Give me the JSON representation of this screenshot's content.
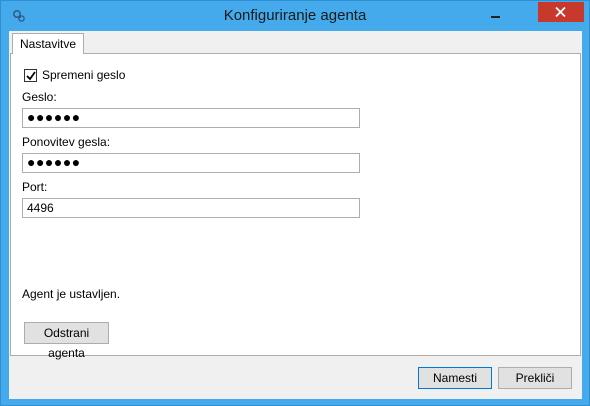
{
  "window": {
    "title": "Konfiguriranje agenta"
  },
  "tabs": [
    {
      "label": "Nastavitve"
    }
  ],
  "settings": {
    "change_password": {
      "label": "Spremeni geslo",
      "checked": true
    },
    "password": {
      "label": "Geslo:",
      "value": "●●●●●●"
    },
    "password_repeat": {
      "label": "Ponovitev gesla:",
      "value": "●●●●●●"
    },
    "port": {
      "label": "Port:",
      "value": "4496"
    },
    "status": "Agent je ustavljen.",
    "remove_label": "Odstrani agenta"
  },
  "footer": {
    "install_label": "Namesti",
    "cancel_label": "Prekliči"
  },
  "colors": {
    "titlebar": "#44aaeb",
    "close": "#c7392d",
    "accent": "#0078d7"
  },
  "icons": [
    "app-icon",
    "minimize-icon",
    "close-icon",
    "checkmark-icon"
  ]
}
